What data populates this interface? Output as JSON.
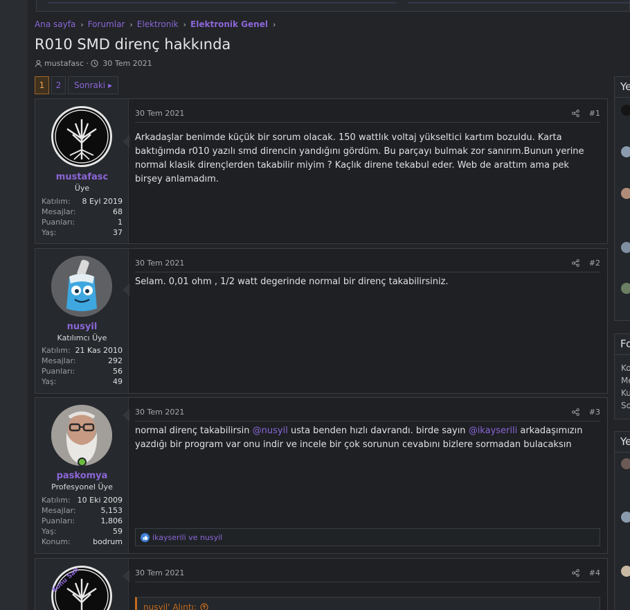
{
  "breadcrumbs": [
    {
      "label": "Ana sayfa"
    },
    {
      "label": "Forumlar"
    },
    {
      "label": "Elektronik"
    },
    {
      "label": "Elektronik Genel"
    }
  ],
  "thread": {
    "title": "R010 SMD direnç hakkında",
    "author": "mustafasc",
    "date": "30 Tem 2021"
  },
  "pagination": {
    "pages": [
      "1",
      "2"
    ],
    "current": "1",
    "next_label": "Sonraki"
  },
  "posts": [
    {
      "user": {
        "name": "mustafasc",
        "title": "Üye",
        "avatar": "tree-of-life",
        "stats": [
          {
            "k": "Katılım:",
            "v": "8 Eyl 2019"
          },
          {
            "k": "Mesajlar:",
            "v": "68"
          },
          {
            "k": "Puanları:",
            "v": "1"
          },
          {
            "k": "Yaş:",
            "v": "37"
          }
        ]
      },
      "date": "30 Tem 2021",
      "number": "#1",
      "body": "Arkadaşlar benimde küçük bir sorum olacak. 150 wattlık voltaj yükseltici kartım bozuldu. Karta baktığımda r010 yazılı smd direncin yandığını gördüm. Bu parçayı bulmak zor sanırım.Bunun yerine normal klasik dirençlerden takabilir miyim ? Kaçlık direne tekabul eder. Web de arattım ama pek birşey anlamadım."
    },
    {
      "user": {
        "name": "nusyil",
        "title": "Katılımcı Üye",
        "avatar": "cartoon-robot",
        "stats": [
          {
            "k": "Katılım:",
            "v": "21 Kas 2010"
          },
          {
            "k": "Mesajlar:",
            "v": "292"
          },
          {
            "k": "Puanları:",
            "v": "56"
          },
          {
            "k": "Yaş:",
            "v": "49"
          }
        ]
      },
      "date": "30 Tem 2021",
      "number": "#2",
      "body": "Selam. 0,01 ohm , 1/2 watt degerinde normal bir direnç takabilirsiniz."
    },
    {
      "user": {
        "name": "paskomya",
        "title": "Profesyonel Üye",
        "avatar": "bearded-man",
        "stats": [
          {
            "k": "Katılım:",
            "v": "10 Eki 2009"
          },
          {
            "k": "Mesajlar:",
            "v": "5,153"
          },
          {
            "k": "Puanları:",
            "v": "1,806"
          },
          {
            "k": "Yaş:",
            "v": "59"
          },
          {
            "k": "Konum:",
            "v": "bodrum"
          }
        ]
      },
      "date": "30 Tem 2021",
      "number": "#3",
      "body_parts": [
        "normal direnç takabilirsin ",
        "@nusyil",
        " usta benden hızlı davrandı. birde sayın ",
        "@ikayserili",
        " arkadaşımızın yazdığı bir program var onu indir ve incele bir çok sorunun cevabını bizlere sormadan bulacaksın"
      ],
      "reactions": "ikayserili ve nusyil"
    },
    {
      "user": {
        "badge": "Konu Sah"
      },
      "date": "30 Tem 2021",
      "number": "#4",
      "quote_label": "nusyil' Alıntı:"
    }
  ],
  "sidebar": {
    "box1_title": "Ye",
    "box2_title": "Fo",
    "box2_lines": [
      "Ko",
      "Me",
      "Ku",
      "So"
    ],
    "box3_title": "Ye"
  },
  "colors": {
    "accent": "#8b66d8",
    "quote_accent": "#c26b1f",
    "online": "#6bbd3d"
  }
}
